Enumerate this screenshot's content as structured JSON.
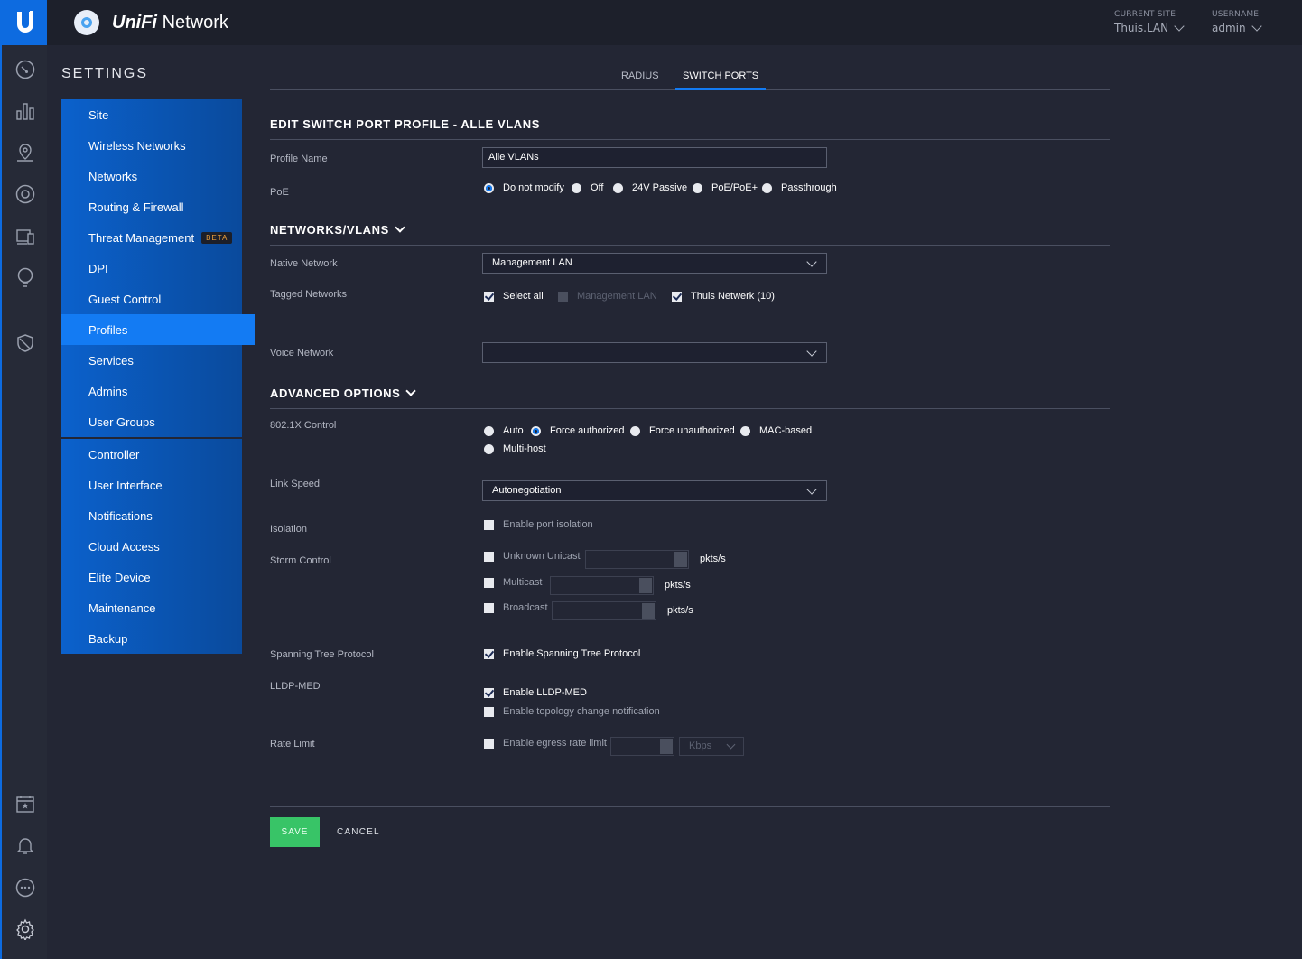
{
  "app": {
    "brand_prefix": "UniFi",
    "brand_suffix": "Network"
  },
  "header": {
    "current_site_label": "CURRENT SITE",
    "current_site_value": "Thuis.LAN",
    "username_label": "USERNAME",
    "username_value": "admin"
  },
  "rail": {
    "top_icons": [
      "dashboard-icon",
      "statistics-icon",
      "map-icon",
      "devices-icon",
      "clients-icon",
      "insights-icon"
    ],
    "bottom_icons": [
      "events-icon",
      "alerts-icon",
      "chat-icon",
      "settings-icon"
    ]
  },
  "settings": {
    "title": "SETTINGS",
    "menu": [
      {
        "label": "Site"
      },
      {
        "label": "Wireless Networks"
      },
      {
        "label": "Networks"
      },
      {
        "label": "Routing & Firewall"
      },
      {
        "label": "Threat Management",
        "badge": "BETA"
      },
      {
        "label": "DPI"
      },
      {
        "label": "Guest Control"
      },
      {
        "label": "Profiles",
        "active": true
      },
      {
        "label": "Services"
      },
      {
        "label": "Admins"
      },
      {
        "label": "User Groups"
      }
    ],
    "menu2": [
      {
        "label": "Controller"
      },
      {
        "label": "User Interface"
      },
      {
        "label": "Notifications"
      },
      {
        "label": "Cloud Access"
      },
      {
        "label": "Elite Device"
      },
      {
        "label": "Maintenance"
      },
      {
        "label": "Backup"
      }
    ]
  },
  "tabs": {
    "radius": "RADIUS",
    "switch_ports": "SWITCH PORTS"
  },
  "form": {
    "title": "EDIT SWITCH PORT PROFILE - ALLE VLANS",
    "profile_name_label": "Profile Name",
    "profile_name_value": "Alle VLANs",
    "poe_label": "PoE",
    "poe_options": [
      "Do not modify",
      "Off",
      "24V Passive",
      "PoE/PoE+",
      "Passthrough"
    ],
    "networks_section": "NETWORKS/VLANS",
    "native_network_label": "Native Network",
    "native_network_value": "Management LAN",
    "tagged_networks_label": "Tagged Networks",
    "tagged_select_all": "Select all",
    "tagged_management": "Management LAN",
    "tagged_thuis": "Thuis Netwerk (10)",
    "voice_network_label": "Voice Network",
    "voice_network_value": "",
    "advanced_section": "ADVANCED OPTIONS",
    "dot1x_label": "802.1X Control",
    "dot1x_options": [
      "Auto",
      "Force authorized",
      "Force unauthorized",
      "MAC-based",
      "Multi-host"
    ],
    "link_speed_label": "Link Speed",
    "link_speed_value": "Autonegotiation",
    "isolation_label": "Isolation",
    "isolation_option": "Enable port isolation",
    "storm_label": "Storm Control",
    "storm_unknown_unicast": "Unknown Unicast",
    "storm_multicast": "Multicast",
    "storm_broadcast": "Broadcast",
    "unit_pkts": "pkts/s",
    "stp_label": "Spanning Tree Protocol",
    "stp_option": "Enable Spanning Tree Protocol",
    "lldp_label": "LLDP-MED",
    "lldp_option": "Enable LLDP-MED",
    "lldp_topology": "Enable topology change notification",
    "rate_limit_label": "Rate Limit",
    "rate_limit_option": "Enable egress rate limit",
    "rate_unit": "Kbps",
    "save": "SAVE",
    "cancel": "CANCEL"
  },
  "colors": {
    "accent": "#137bf3",
    "save": "#38c467",
    "background": "#232634"
  }
}
